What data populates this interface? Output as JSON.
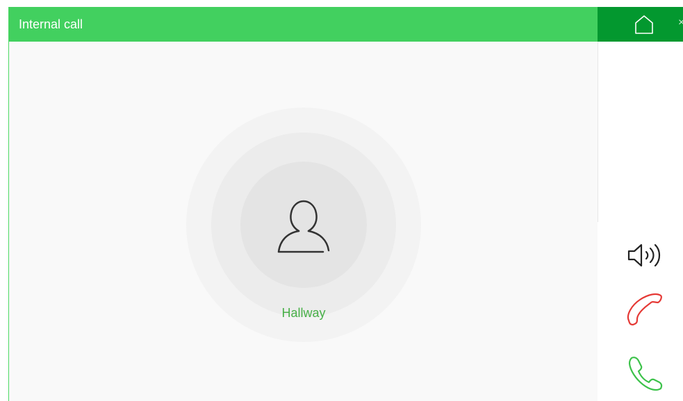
{
  "header": {
    "title": "Internal call"
  },
  "toolbar": {
    "home_icon": "home-icon",
    "close_glyph": "×"
  },
  "caller": {
    "name": "Hallway",
    "avatar_icon": "person-icon"
  },
  "controls": {
    "speaker_icon": "speaker-icon",
    "hangup_icon": "hangup-icon",
    "answer_icon": "answer-icon"
  },
  "colors": {
    "header_green": "#42d05f",
    "home_green": "#03982f",
    "name_green": "#48b048",
    "hangup_red": "#e53935",
    "answer_green": "#3cc24a"
  }
}
